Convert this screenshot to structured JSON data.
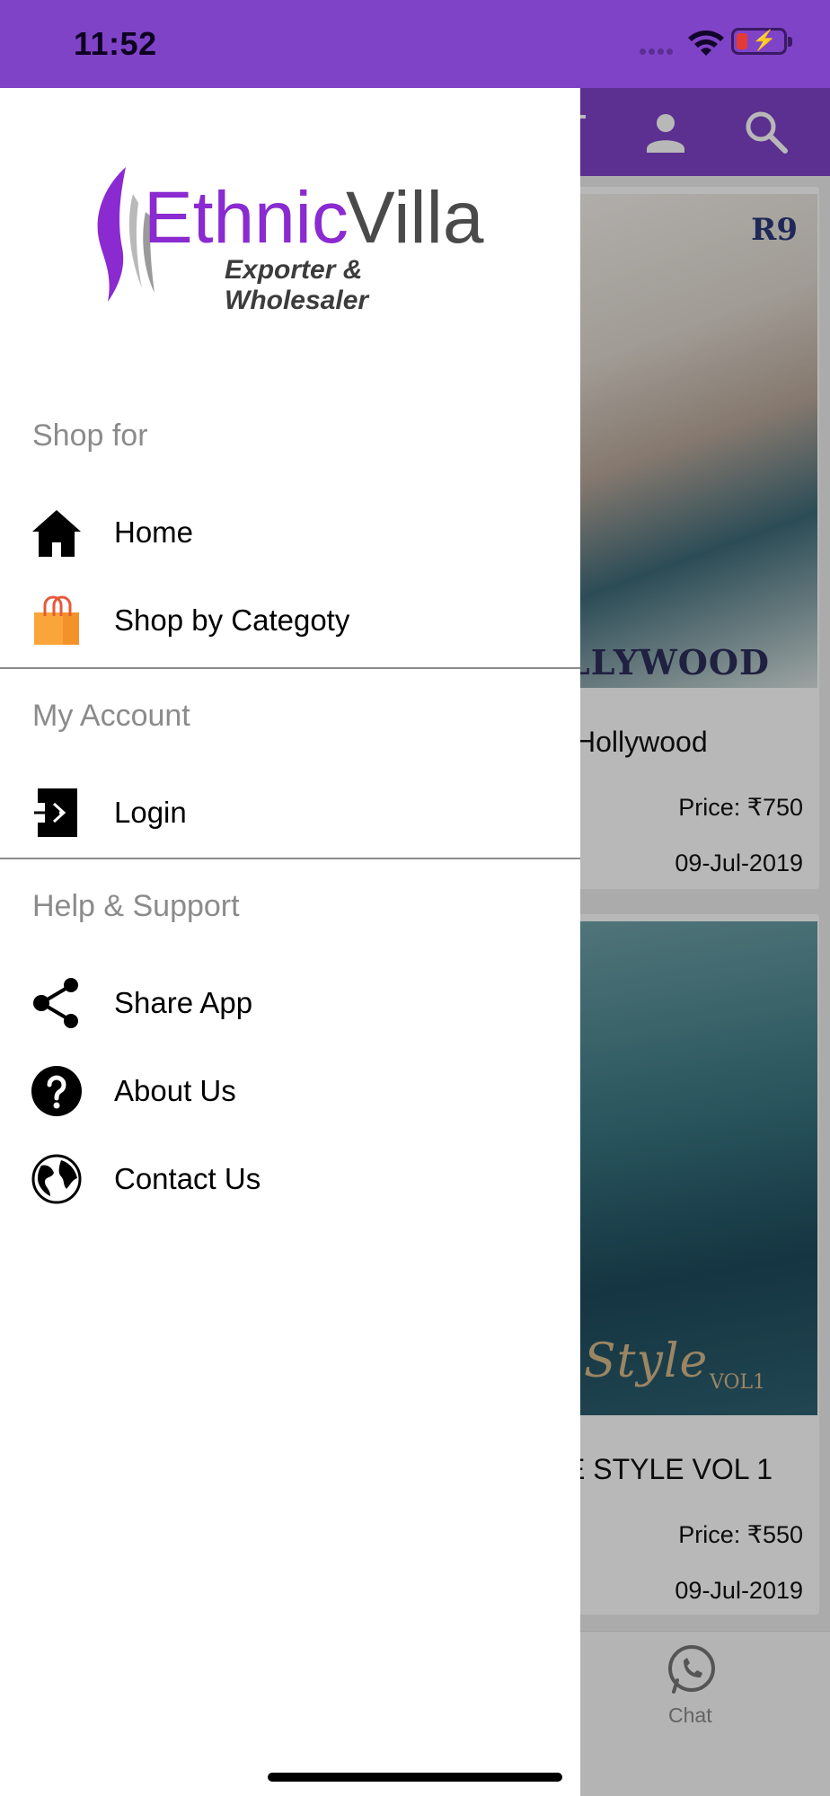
{
  "status_bar": {
    "time": "11:52",
    "bg_color": "#7f43c8"
  },
  "background_app": {
    "header_icons": [
      "user-icon",
      "search-icon"
    ],
    "cards": [
      {
        "image_brand": "R9",
        "image_caption": "LLYWOOD",
        "title": "Hollywood",
        "price": "Price: ₹750",
        "date": "09-Jul-2019"
      },
      {
        "image_caption": "Style",
        "image_subcaption": "VOL1",
        "title": "E STYLE VOL 1",
        "price": "Price: ₹550",
        "date": "09-Jul-2019"
      }
    ],
    "bottom_nav": {
      "chat_label": "Chat"
    }
  },
  "drawer": {
    "logo": {
      "word1": "Ethnic",
      "word2": "Villa",
      "tagline": "Exporter & Wholesaler",
      "primary_color": "#8a2ad0"
    },
    "sections": [
      {
        "label": "Shop for",
        "items": [
          {
            "label": "Home",
            "icon": "home-icon"
          },
          {
            "label": "Shop by Categoty",
            "icon": "shopping-bag-icon"
          }
        ]
      },
      {
        "label": "My Account",
        "items": [
          {
            "label": "Login",
            "icon": "login-icon"
          }
        ]
      },
      {
        "label": "Help & Support",
        "items": [
          {
            "label": "Share App",
            "icon": "share-icon"
          },
          {
            "label": "About Us",
            "icon": "help-circle-icon"
          },
          {
            "label": "Contact Us",
            "icon": "globe-icon"
          }
        ]
      }
    ]
  }
}
